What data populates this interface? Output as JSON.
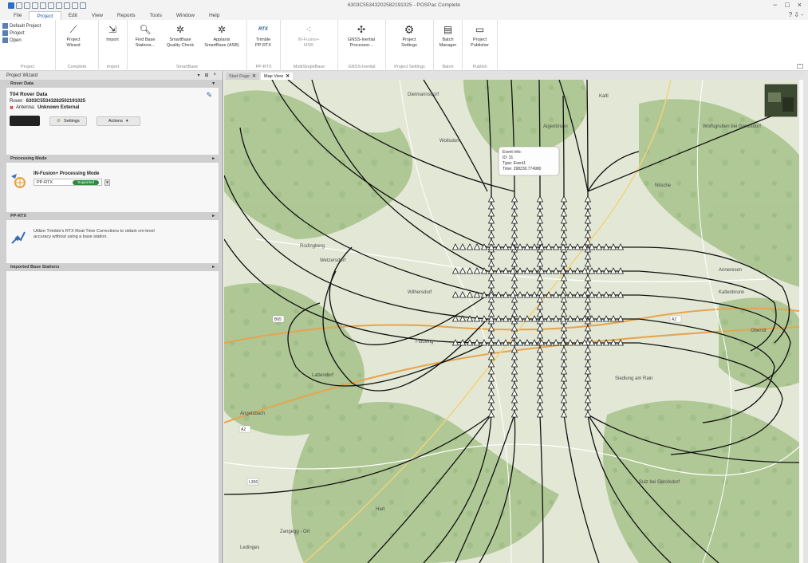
{
  "window": {
    "title": "6303C55343202582191025 - POSPac Complete",
    "controls": [
      "−",
      "□",
      "×"
    ],
    "help": "? ⇩ -"
  },
  "menu": {
    "items": [
      {
        "label": "File",
        "active": false
      },
      {
        "label": "Project",
        "active": true
      },
      {
        "label": "Edit",
        "active": false
      },
      {
        "label": "View",
        "active": false
      },
      {
        "label": "Reports",
        "active": false
      },
      {
        "label": "Tools",
        "active": false
      },
      {
        "label": "Window",
        "active": false
      },
      {
        "label": "Help",
        "active": false
      }
    ]
  },
  "ribbon": {
    "project_group": {
      "items": [
        "Default Project",
        "Project",
        "Open"
      ],
      "name": "Project"
    },
    "complete_group": {
      "button": "Project\nWizard",
      "name": "Complete"
    },
    "import_group": {
      "button": "Import",
      "name": "Import"
    },
    "smartbase_group": {
      "buttons": [
        "Find Base\nStations...",
        "SmartBase\nQuality Check",
        "Applanix\nSmartBase (ASB)"
      ],
      "name": "SmartBase"
    },
    "pprtx_group": {
      "button": "Trimble\nPP-RTX",
      "icon_text": "RTX",
      "name": "PP-RTX"
    },
    "msb_group": {
      "button": "IN-Fusion+\nMSB",
      "name": "MultiSingleBase"
    },
    "gnss_group": {
      "button": "GNSS-Inertial\nProcessor...",
      "name": "GNSS-Inertial"
    },
    "settings_group": {
      "button": "Project\nSettings",
      "name": "Project Settings"
    },
    "batch_group": {
      "button": "Batch\nManager",
      "name": "Batch"
    },
    "publish_group": {
      "button": "Project\nPublisher",
      "name": "Publish"
    }
  },
  "wizard": {
    "panel_title": "Project Wizard",
    "panel_controls": [
      "▾",
      "⊞",
      "×"
    ],
    "rover_section": {
      "header": "Rover Data",
      "title": "T04 Rover Data",
      "rover_label": "Rover:",
      "rover_value": "6303C55343282502191025",
      "antenna_label": "Antenna:",
      "antenna_value": "Unknown External",
      "settings_btn": "Settings",
      "actions_btn": "Actions"
    },
    "processing_section": {
      "header": "Processing Mode",
      "mode_title": "IN-Fusion+ Processing Mode",
      "mode_value": "PP-RTX",
      "badge": "Supported"
    },
    "pprtx_section": {
      "header": "PP-RTX",
      "description": "Utilize Trimble's RTX Real-Time Corrections to obtain cm-level accuracy without using a base station."
    },
    "imported_section": {
      "header": "Imported Base Stations"
    }
  },
  "map": {
    "tabs": [
      {
        "label": "Start Page",
        "active": false
      },
      {
        "label": "Map View",
        "active": true
      }
    ],
    "tooltip": {
      "line1": "Event Info:",
      "line2": "ID: 31",
      "line3": "Type: Event1",
      "line4": "Time: 298230.774980"
    },
    "place_labels": [
      "Dietmannsdorf",
      "Kaltl",
      "Aigenbrunn",
      "Wolfsgruben bei Gerolsdorf",
      "Wollsdorf",
      "Nitsche",
      "Rodingberg",
      "Wetzersdorf",
      "Anneresen",
      "Kaltenbrunn",
      "Wilhersdorf",
      "Flocking",
      "Oberstr",
      "Siedlung am Rain",
      "Lattendorf",
      "Angelsbach",
      "Sulz bei Gerolsdorf",
      "Hart",
      "Zangegg - Ort",
      "Ledinges"
    ],
    "road_labels": [
      "B65",
      "A2",
      "A2",
      "L306"
    ]
  },
  "colors": {
    "accent": "#2a5aa0",
    "map_background": "#dfe6d4",
    "track": "#111111",
    "badge": "#2e8b3d"
  }
}
